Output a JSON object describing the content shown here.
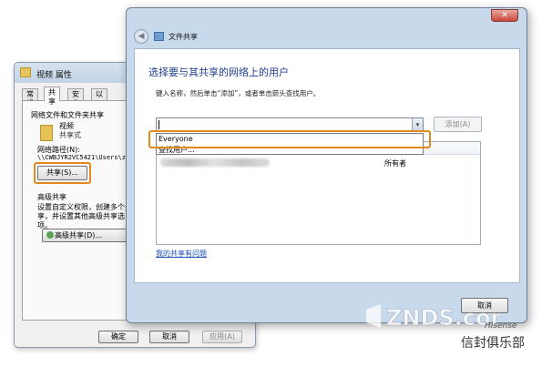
{
  "properties_dialog": {
    "title": "视频 属性",
    "tabs": [
      "常规",
      "共享",
      "安全",
      "以"
    ],
    "group_title": "网络文件和文件夹共享",
    "folder_name": "视频",
    "folder_status": "共享式",
    "path_label": "网络路径(N):",
    "path_value": "\\\\CWBJYR2VC5421\\Users\\z",
    "share_button": "共享(S)...",
    "advanced_title": "高级共享",
    "advanced_desc": "设置自定义权限，创建多个共享，并设置其他高级共享选项。",
    "advanced_button": "高级共享(D)...",
    "ok": "确定",
    "cancel": "取消",
    "apply": "应用(A)"
  },
  "wizard": {
    "close_symbol": "✕",
    "back_symbol": "◀",
    "title": "文件共享",
    "heading": "选择要与其共享的网络上的用户",
    "instruction": "键入名称，然后单击“添加”，或者单击箭头查找用户。",
    "combo_value": "",
    "dropdown_arrow": "▾",
    "add_button": "添加(A)",
    "dropdown_options": [
      "Everyone",
      "查找用户..."
    ],
    "list_rows": [
      {
        "name": "(blurred)",
        "role": "所有者"
      }
    ],
    "help_link": "我的共享有问题",
    "cancel_button": "取消"
  },
  "watermark": {
    "logo": "ZNDS.com",
    "brand": "Hisense",
    "text": "信封俱乐部"
  },
  "colors": {
    "highlight": "#e08a1e",
    "heading": "#1f3f8f",
    "link": "#1f52b8"
  }
}
